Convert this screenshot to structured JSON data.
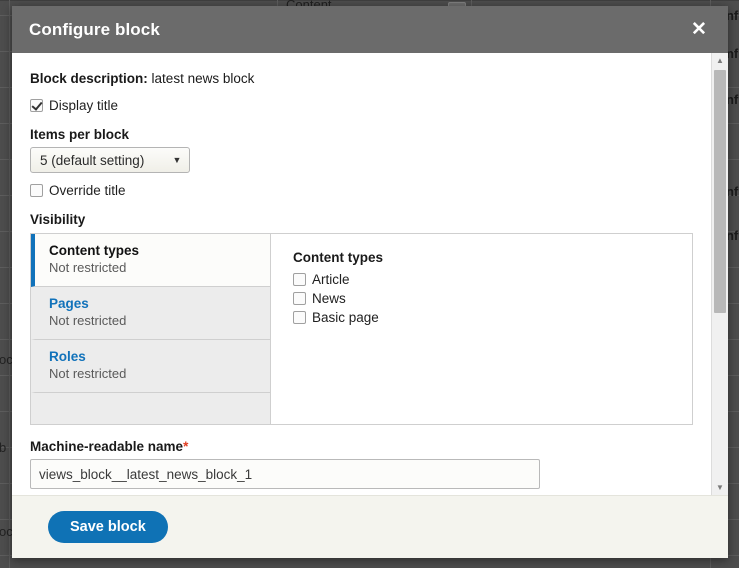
{
  "background": {
    "column_header": "Content",
    "left_fragments": [
      "oc",
      "b",
      "oc"
    ],
    "right_links": [
      "onfi",
      "onfi",
      "onfi",
      "onfi",
      "onfi"
    ],
    "row_positions": [
      14,
      50,
      86,
      122,
      158,
      194,
      230,
      266,
      302,
      338,
      374,
      410,
      446,
      482,
      518,
      554
    ],
    "left_fragment_positions": [
      352,
      440,
      524
    ],
    "right_link_positions": [
      8,
      46,
      92,
      184,
      228
    ],
    "overlay_color": "#4d4d4d"
  },
  "modal": {
    "title": "Configure block",
    "close_label": "✕",
    "titlebar_color": "#6b6b6b",
    "block_description_label": "Block description:",
    "block_description_value": "latest news block",
    "display_title": {
      "label": "Display title",
      "checked": true
    },
    "items_per_block": {
      "label": "Items per block",
      "selected": "5 (default setting)",
      "arrow": "▼"
    },
    "override_title": {
      "label": "Override title",
      "checked": false
    },
    "visibility": {
      "label": "Visibility",
      "tabs": [
        {
          "title": "Content types",
          "summary": "Not restricted",
          "active": true
        },
        {
          "title": "Pages",
          "summary": "Not restricted",
          "active": false
        },
        {
          "title": "Roles",
          "summary": "Not restricted",
          "active": false
        }
      ],
      "pane": {
        "title": "Content types",
        "options": [
          {
            "label": "Article",
            "checked": false
          },
          {
            "label": "News",
            "checked": false
          },
          {
            "label": "Basic page",
            "checked": false
          }
        ]
      }
    },
    "machine_name": {
      "label": "Machine-readable name",
      "required_marker": "*",
      "value": "views_block__latest_news_block_1"
    },
    "footer": {
      "save_label": "Save block",
      "accent_color": "#0f72b5"
    },
    "scrollbar": {
      "up_arrow": "▲",
      "down_arrow": "▼"
    }
  }
}
